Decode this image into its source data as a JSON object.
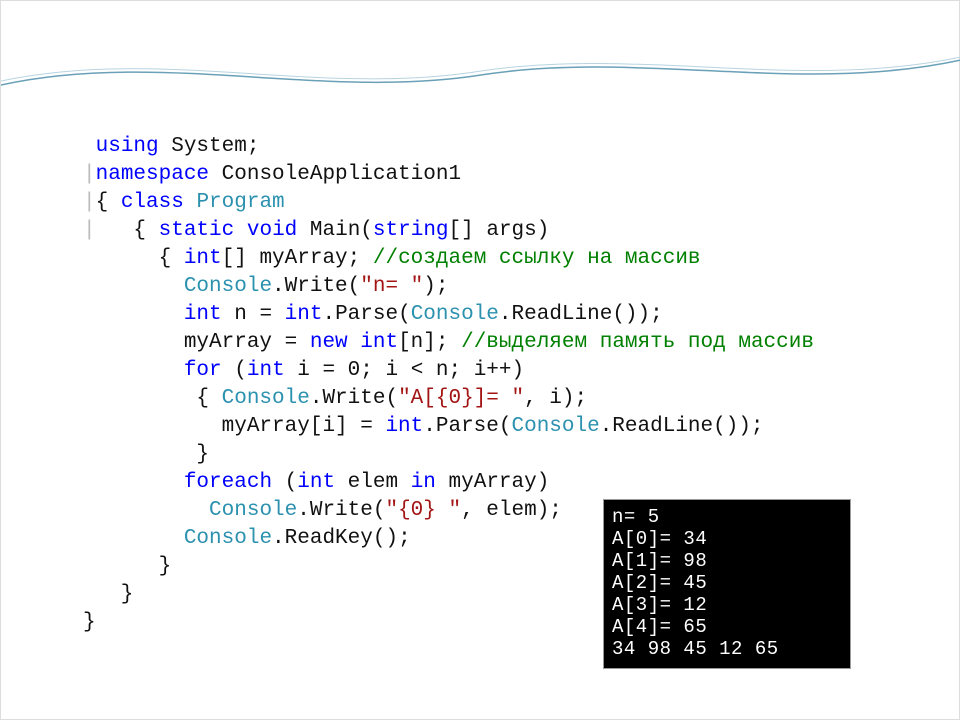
{
  "code": {
    "l01_using": "using",
    "l01_system": " System;",
    "l02_ns": "namespace",
    "l02_rest": " ConsoleApplication1",
    "l03_open": "{ ",
    "l03_class": "class",
    "l03_prog": " Program",
    "l04_open": "   { ",
    "l04_static": "static",
    "l04_sp1": " ",
    "l04_void": "void",
    "l04_sp2": " Main(",
    "l04_string": "string",
    "l04_rest": "[] args)",
    "l05_open": "      { ",
    "l05_int": "int",
    "l05_arr": "[] myArray; ",
    "l05_cmt": "//создаем ссылку на массив",
    "l06_pad": "        ",
    "l06_console": "Console",
    "l06_write": ".Write(",
    "l06_str": "\"n= \"",
    "l06_end": ");",
    "l07_pad": "        ",
    "l07_int": "int",
    "l07_mid": " n = ",
    "l07_int2": "int",
    "l07_parse": ".Parse(",
    "l07_console": "Console",
    "l07_read": ".ReadLine());",
    "l08_pad": "        myArray = ",
    "l08_new": "new",
    "l08_sp": " ",
    "l08_int": "int",
    "l08_rest": "[n]; ",
    "l08_cmt": "//выделяем память под массив",
    "l09_pad": "        ",
    "l09_for": "for",
    "l09_open": " (",
    "l09_int": "int",
    "l09_rest": " i = 0; i < n; i++)",
    "l10_pad": "         { ",
    "l10_console": "Console",
    "l10_write": ".Write(",
    "l10_str": "\"A[{0}]= \"",
    "l10_rest": ", i);",
    "l11_pad": "           myArray[i] = ",
    "l11_int": "int",
    "l11_parse": ".Parse(",
    "l11_console": "Console",
    "l11_read": ".ReadLine());",
    "l12_pad": "         }",
    "l13_pad": "        ",
    "l13_foreach": "foreach",
    "l13_open": " (",
    "l13_int": "int",
    "l13_mid": " elem ",
    "l13_in": "in",
    "l13_rest": " myArray)",
    "l14_pad": "          ",
    "l14_console": "Console",
    "l14_write": ".Write(",
    "l14_str": "\"{0} \"",
    "l14_rest": ", elem);",
    "l15_pad": "        ",
    "l15_console": "Console",
    "l15_read": ".ReadKey();",
    "l16_pad": "      }",
    "l17_pad": "   }",
    "l18_pad": "}",
    "bar": "|"
  },
  "console": {
    "l1": "n= 5",
    "l2": "A[0]= 34",
    "l3": "A[1]= 98",
    "l4": "A[2]= 45",
    "l5": "A[3]= 12",
    "l6": "A[4]= 65",
    "l7": "34 98 45 12 65"
  }
}
